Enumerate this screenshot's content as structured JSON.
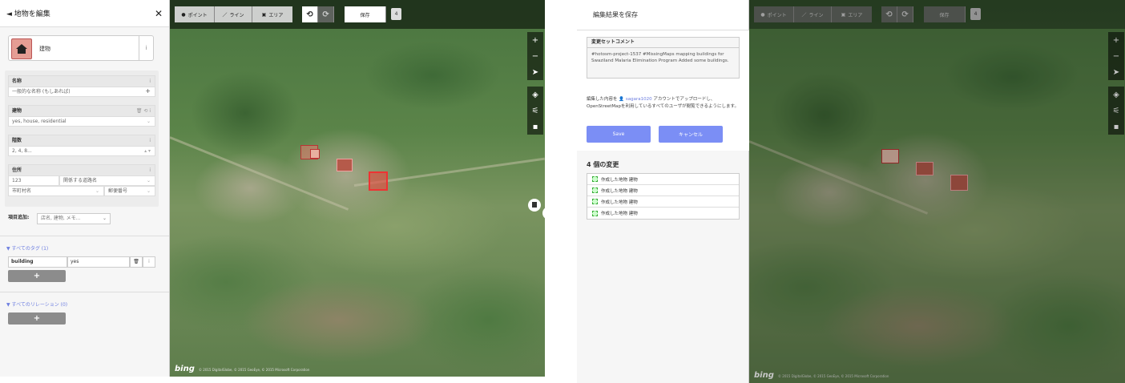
{
  "left_panel": {
    "header_title": "◄ 地物を編集",
    "close_glyph": "✕",
    "preset_name": "建物",
    "info_glyph": "i",
    "fields": {
      "name_label": "名称",
      "name_value": "一般的な名称 (もしあれば)",
      "building_label": "建物",
      "building_value": "yes, house, residential",
      "levels_label": "階数",
      "levels_value": "2, 4, 8...",
      "address_label": "住所",
      "address_housenumber": "123",
      "address_street": "関係する道路名",
      "address_city": "市町村名",
      "address_postcode": "郵便番号"
    },
    "add_field_label": "項目追加:",
    "add_field_placeholder": "店名, 建物, メモ...",
    "all_tags_label": "▼ すべてのタグ (1)",
    "tag_key": "building",
    "tag_value": "yes",
    "add_button": "+",
    "all_relations_label": "▼ すべてのリレーション (0)"
  },
  "map_left": {
    "tools": {
      "point": "ポイント",
      "line": "ライン",
      "area": "エリア"
    },
    "undo_glyph": "⟲",
    "redo_glyph": "⟳",
    "save_label": "保存",
    "edit_count": "4",
    "zoom_in": "+",
    "zoom_out": "−",
    "bing": "bing",
    "attribution": "© 2015 DigitalGlobe, © 2015 GeoEye, © 2015 Microsoft Corporation"
  },
  "save_panel": {
    "header_title": "編集結果を保存",
    "comment_label": "変更セットコメント",
    "comment_text": "#hotosm-project-1537 #MissingMaps mapping buildings for Swaziland Malaria Elimination Program Added some buildings.",
    "upload_pre": "編集した内容を ",
    "upload_user": "sagara1020",
    "upload_post": " アカウントでアップロードし、OpenStreetMapを利用しているすべてのユーザが閲覧できるようにします。",
    "save_button": "Save",
    "cancel_button": "キャンセル",
    "changes_title": "4 個の変更",
    "changes": [
      "作成した地物 建物",
      "作成した地物 建物",
      "作成した地物 建物",
      "作成した地物 建物"
    ]
  },
  "colors": {
    "accent_blue": "#7b8ef5",
    "building_fill": "#e59d94",
    "toolbar_bg": "#000000"
  }
}
